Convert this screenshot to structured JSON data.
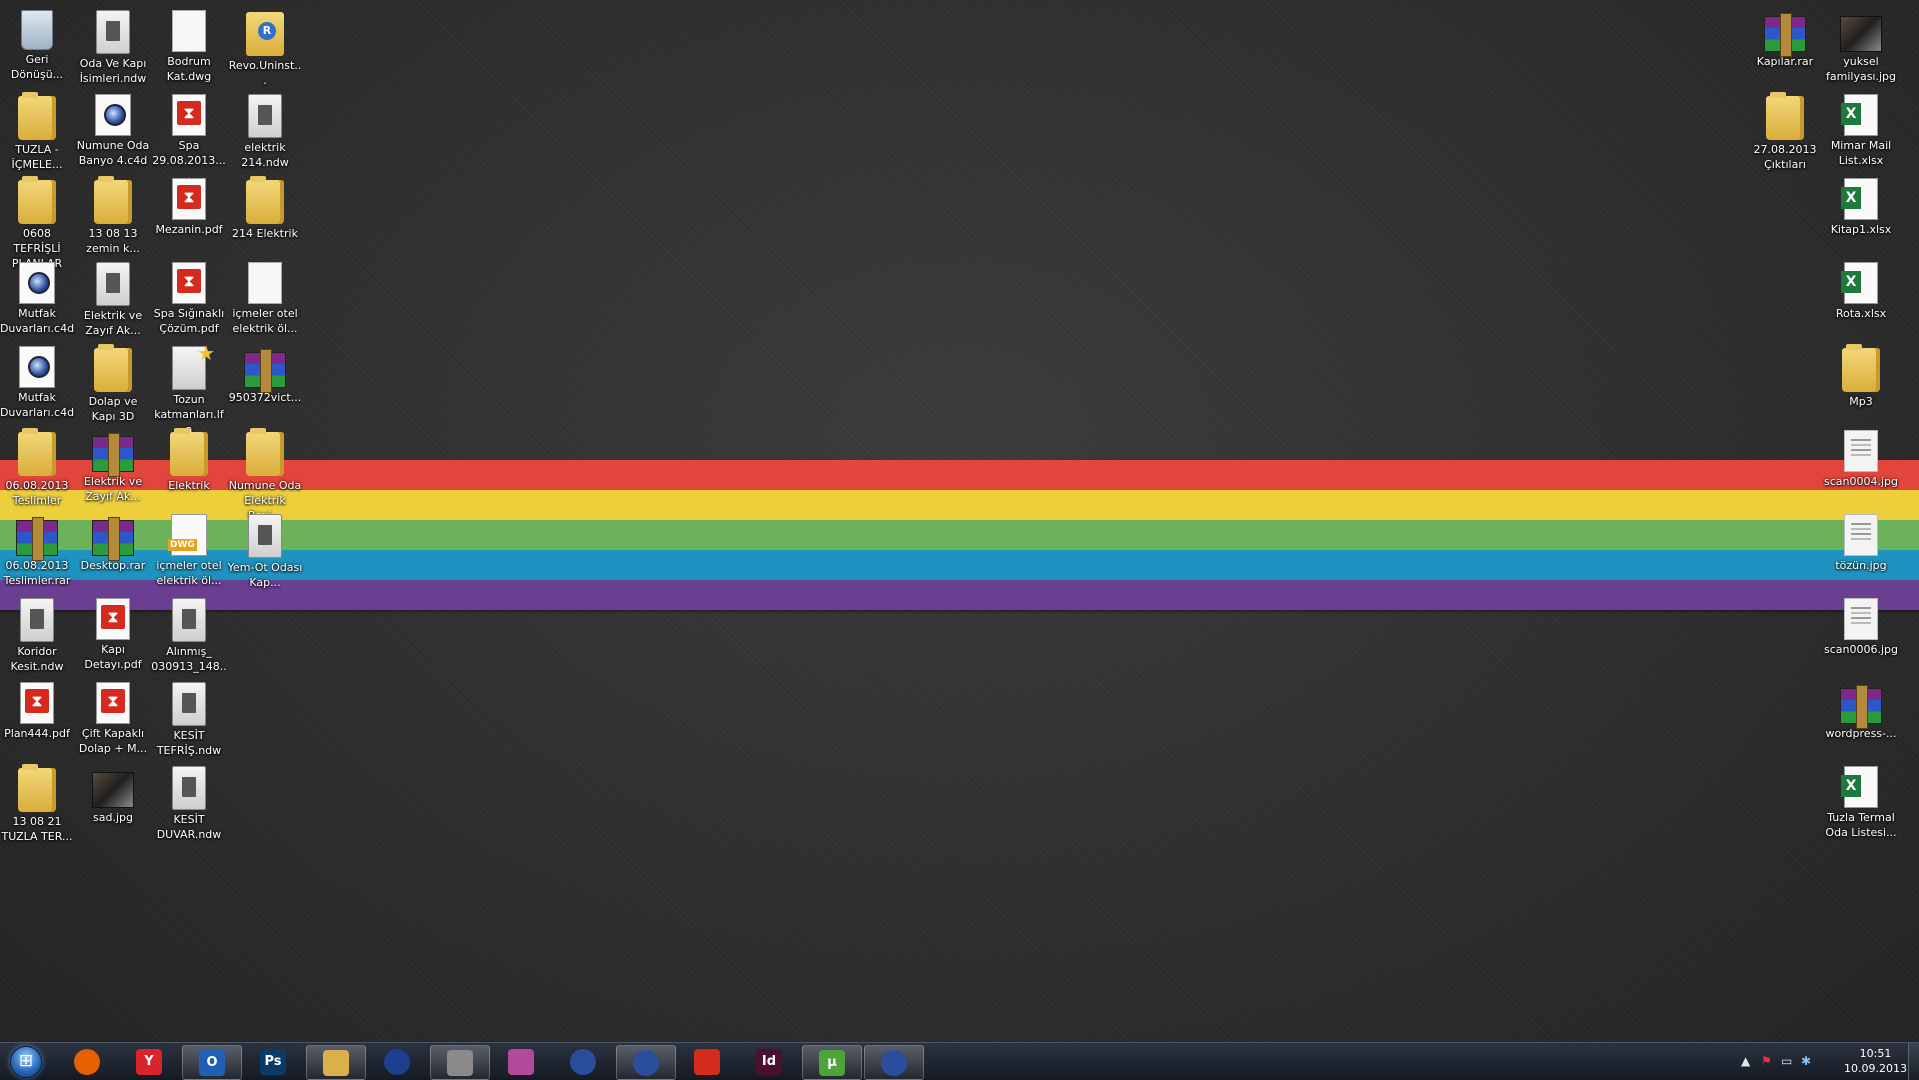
{
  "wallpaper": {
    "background": "#2e2e2e",
    "stripes": [
      "#e2453b",
      "#eccf3b",
      "#6cb25a",
      "#1f93bf",
      "#6a3f92"
    ]
  },
  "desktop": {
    "left_icons": [
      {
        "label": "Geri Dönüşü...",
        "icon": "recycle-bin-icon"
      },
      {
        "label": "TUZLA - İÇMELE...",
        "icon": "folder-icon"
      },
      {
        "label": "0608 TEFRİŞLİ PLANLAR",
        "icon": "folder-icon"
      },
      {
        "label": "Mutfak Duvarları.c4d",
        "icon": "cinema4d-file-icon"
      },
      {
        "label": "Mutfak Duvarları.c4d",
        "icon": "cinema4d-file-icon"
      },
      {
        "label": "06.08.2013 Teslimler",
        "icon": "folder-icon"
      },
      {
        "label": "06.08.2013 Teslimler.rar",
        "icon": "rar-archive-icon"
      },
      {
        "label": "Koridor Kesit.ndw",
        "icon": "ndw-file-icon"
      },
      {
        "label": "Plan444.pdf",
        "icon": "pdf-file-icon"
      },
      {
        "label": "13 08 21 TUZLA TER...",
        "icon": "folder-icon"
      },
      {
        "label": "Oda Ve Kapı İsimleri.ndw",
        "icon": "ndw-file-icon"
      },
      {
        "label": "Numune Oda Banyo 4.c4d",
        "icon": "cinema4d-file-icon"
      },
      {
        "label": "13 08 13 zemin k...",
        "icon": "folder-icon"
      },
      {
        "label": "Elektrik ve Zayıf Ak...",
        "icon": "ndw-file-icon"
      },
      {
        "label": "Dolap ve Kapı 3D",
        "icon": "folder-icon"
      },
      {
        "label": "Elektrik ve Zayıf Ak...",
        "icon": "rar-archive-icon"
      },
      {
        "label": "Desktop.rar",
        "icon": "rar-archive-icon"
      },
      {
        "label": "Kapı Detayı.pdf",
        "icon": "pdf-file-icon"
      },
      {
        "label": "Çift Kapaklı Dolap + M...",
        "icon": "pdf-file-icon"
      },
      {
        "label": "sad.jpg",
        "icon": "photo-file-icon"
      },
      {
        "label": "Bodrum Kat.dwg",
        "icon": "document-icon"
      },
      {
        "label": "Spa 29.08.2013....",
        "icon": "pdf-file-icon"
      },
      {
        "label": "Mezanin.pdf",
        "icon": "pdf-file-icon"
      },
      {
        "label": "Spa Sığınaklı Çözüm.pdf",
        "icon": "pdf-file-icon"
      },
      {
        "label": "Tozun katmanları.lfa",
        "icon": "lfa-file-icon"
      },
      {
        "label": "Elektrik",
        "icon": "folder-icon"
      },
      {
        "label": "içmeler otel elektrik öl...",
        "icon": "dwg-file-icon"
      },
      {
        "label": "Alınmış_ 030913_148...",
        "icon": "ndw-file-icon"
      },
      {
        "label": "KESİT TEFRİŞ.ndw",
        "icon": "ndw-file-icon"
      },
      {
        "label": "KESİT DUVAR.ndw",
        "icon": "ndw-file-icon"
      },
      {
        "label": "Revo.Uninst...",
        "icon": "revo-uninstaller-icon"
      },
      {
        "label": "elektrik 214.ndw",
        "icon": "ndw-file-icon"
      },
      {
        "label": "214 Elektrik",
        "icon": "folder-icon"
      },
      {
        "label": "içmeler otel elektrik öl...",
        "icon": "document-icon"
      },
      {
        "label": "950372vict...",
        "icon": "rar-archive-icon"
      },
      {
        "label": "Numune Oda Elektrik Revi...",
        "icon": "folder-icon"
      },
      {
        "label": "Yem-Ot Odası Kap...",
        "icon": "ndw-file-icon"
      }
    ],
    "right_icons": [
      {
        "label": "Kapılar.rar",
        "icon": "rar-archive-icon"
      },
      {
        "label": "27.08.2013 Çıktıları",
        "icon": "folder-icon"
      },
      {
        "label": "yuksel familyası.jpg",
        "icon": "photo-file-icon"
      },
      {
        "label": "Mimar Mail List.xlsx",
        "icon": "excel-file-icon"
      },
      {
        "label": "Kitap1.xlsx",
        "icon": "excel-file-icon"
      },
      {
        "label": "Rota.xlsx",
        "icon": "excel-file-icon"
      },
      {
        "label": "Mp3",
        "icon": "folder-icon"
      },
      {
        "label": "scan0004.jpg",
        "icon": "scan-image-icon"
      },
      {
        "label": "tözün.jpg",
        "icon": "scan-image-icon"
      },
      {
        "label": "scan0006.jpg",
        "icon": "scan-image-icon"
      },
      {
        "label": "wordpress-...",
        "icon": "rar-archive-icon"
      },
      {
        "label": "Tuzla Termal Oda Listesi...",
        "icon": "excel-file-icon"
      }
    ]
  },
  "taskbar": {
    "start_icon": "windows-start-orb-icon",
    "apps": [
      {
        "name": "firefox",
        "icon": "firefox-icon",
        "glyph": "",
        "color": "#e66000",
        "active": false
      },
      {
        "name": "yandex",
        "icon": "yandex-browser-icon",
        "glyph": "Y",
        "color": "#d9232d",
        "active": false
      },
      {
        "name": "outlook",
        "icon": "outlook-icon",
        "glyph": "O",
        "color": "#1f5fb4",
        "active": true
      },
      {
        "name": "photoshop",
        "icon": "photoshop-icon",
        "glyph": "Ps",
        "color": "#0a3a66",
        "active": false
      },
      {
        "name": "explorer",
        "icon": "file-explorer-icon",
        "glyph": "",
        "color": "#d9b04a",
        "active": true
      },
      {
        "name": "cinema4d",
        "icon": "cinema4d-icon",
        "glyph": "",
        "color": "#1d3f8f",
        "active": false
      },
      {
        "name": "cad-app",
        "icon": "cad-app-icon",
        "glyph": "",
        "color": "#8a8a8a",
        "active": true
      },
      {
        "name": "paint-tool",
        "icon": "paint-tool-icon",
        "glyph": "",
        "color": "#b04a9a",
        "active": false
      },
      {
        "name": "cinema4d-2",
        "icon": "cinema4d-icon",
        "glyph": "",
        "color": "#2a4d9e",
        "active": false
      },
      {
        "name": "cinema4d-3",
        "icon": "cinema4d-icon",
        "glyph": "",
        "color": "#2a4d9e",
        "active": true
      },
      {
        "name": "acrobat",
        "icon": "acrobat-icon",
        "glyph": "",
        "color": "#d52b1e",
        "active": false
      },
      {
        "name": "indesign",
        "icon": "indesign-icon",
        "glyph": "Id",
        "color": "#4a1030",
        "active": false
      },
      {
        "name": "utorrent",
        "icon": "utorrent-icon",
        "glyph": "µ",
        "color": "#4ea33a",
        "active": true
      },
      {
        "name": "cinema4d-4",
        "icon": "cinema4d-icon",
        "glyph": "",
        "color": "#2a4d9e",
        "active": true
      }
    ],
    "tray": {
      "icons": [
        "show-hidden-icons-arrow-icon",
        "action-center-flag-icon",
        "network-icon",
        "bluetooth-icon"
      ],
      "time": "10:51",
      "date": "10.09.2013"
    }
  }
}
